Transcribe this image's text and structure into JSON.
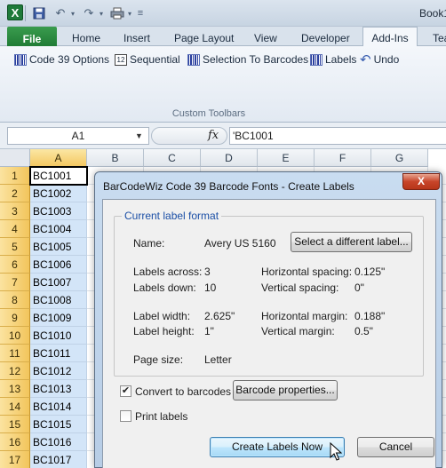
{
  "app": {
    "app_icon_letter": "X",
    "doc_title": "Book1"
  },
  "qat": {
    "save_icon": "floppy-disk",
    "undo_icon": "undo-arrow",
    "redo_icon": "redo-arrow",
    "print_icon": "printer"
  },
  "tabs": {
    "file": "File",
    "home": "Home",
    "insert": "Insert",
    "page_layout": "Page Layout",
    "view": "View",
    "developer": "Developer",
    "addins": "Add-Ins",
    "team": "Tea"
  },
  "ribbon": {
    "buttons": {
      "code39": "Code 39 Options",
      "sequential": "Sequential",
      "selection": "Selection To Barcodes",
      "labels": "Labels",
      "undo": "Undo"
    },
    "group_label": "Custom Toolbars"
  },
  "formula_bar": {
    "name_box": "A1",
    "fx": "fx",
    "formula": "'BC1001"
  },
  "grid": {
    "columns": [
      "A",
      "B",
      "C",
      "D",
      "E",
      "F",
      "G"
    ],
    "rows": [
      "1",
      "2",
      "3",
      "4",
      "5",
      "6",
      "7",
      "8",
      "9",
      "10",
      "11",
      "12",
      "13",
      "14",
      "15",
      "16",
      "17"
    ],
    "col_a": [
      "BC1001",
      "BC1002",
      "BC1003",
      "BC1004",
      "BC1005",
      "BC1006",
      "BC1007",
      "BC1008",
      "BC1009",
      "BC1010",
      "BC1011",
      "BC1012",
      "BC1013",
      "BC1014",
      "BC1015",
      "BC1016",
      "BC1017"
    ]
  },
  "dialog": {
    "title": "BarCodeWiz Code 39 Barcode Fonts - Create Labels",
    "close": "X",
    "group_title": "Current label format",
    "name_label": "Name:",
    "name_value": "Avery US 5160",
    "select_button": "Select a different label...",
    "labels_across_label": "Labels across:",
    "labels_across_value": "3",
    "labels_down_label": "Labels down:",
    "labels_down_value": "10",
    "h_spacing_label": "Horizontal spacing:",
    "h_spacing_value": "0.125\"",
    "v_spacing_label": "Vertical spacing:",
    "v_spacing_value": "0\"",
    "label_width_label": "Label width:",
    "label_width_value": "2.625\"",
    "label_height_label": "Label height:",
    "label_height_value": "1\"",
    "h_margin_label": "Horizontal margin:",
    "h_margin_value": "0.188\"",
    "v_margin_label": "Vertical margin:",
    "v_margin_value": "0.5\"",
    "page_size_label": "Page size:",
    "page_size_value": "Letter",
    "convert_label": "Convert to barcodes",
    "convert_checked": true,
    "barcode_props_button": "Barcode properties...",
    "print_label": "Print labels",
    "print_checked": false,
    "create_button": "Create Labels Now",
    "cancel_button": "Cancel"
  }
}
